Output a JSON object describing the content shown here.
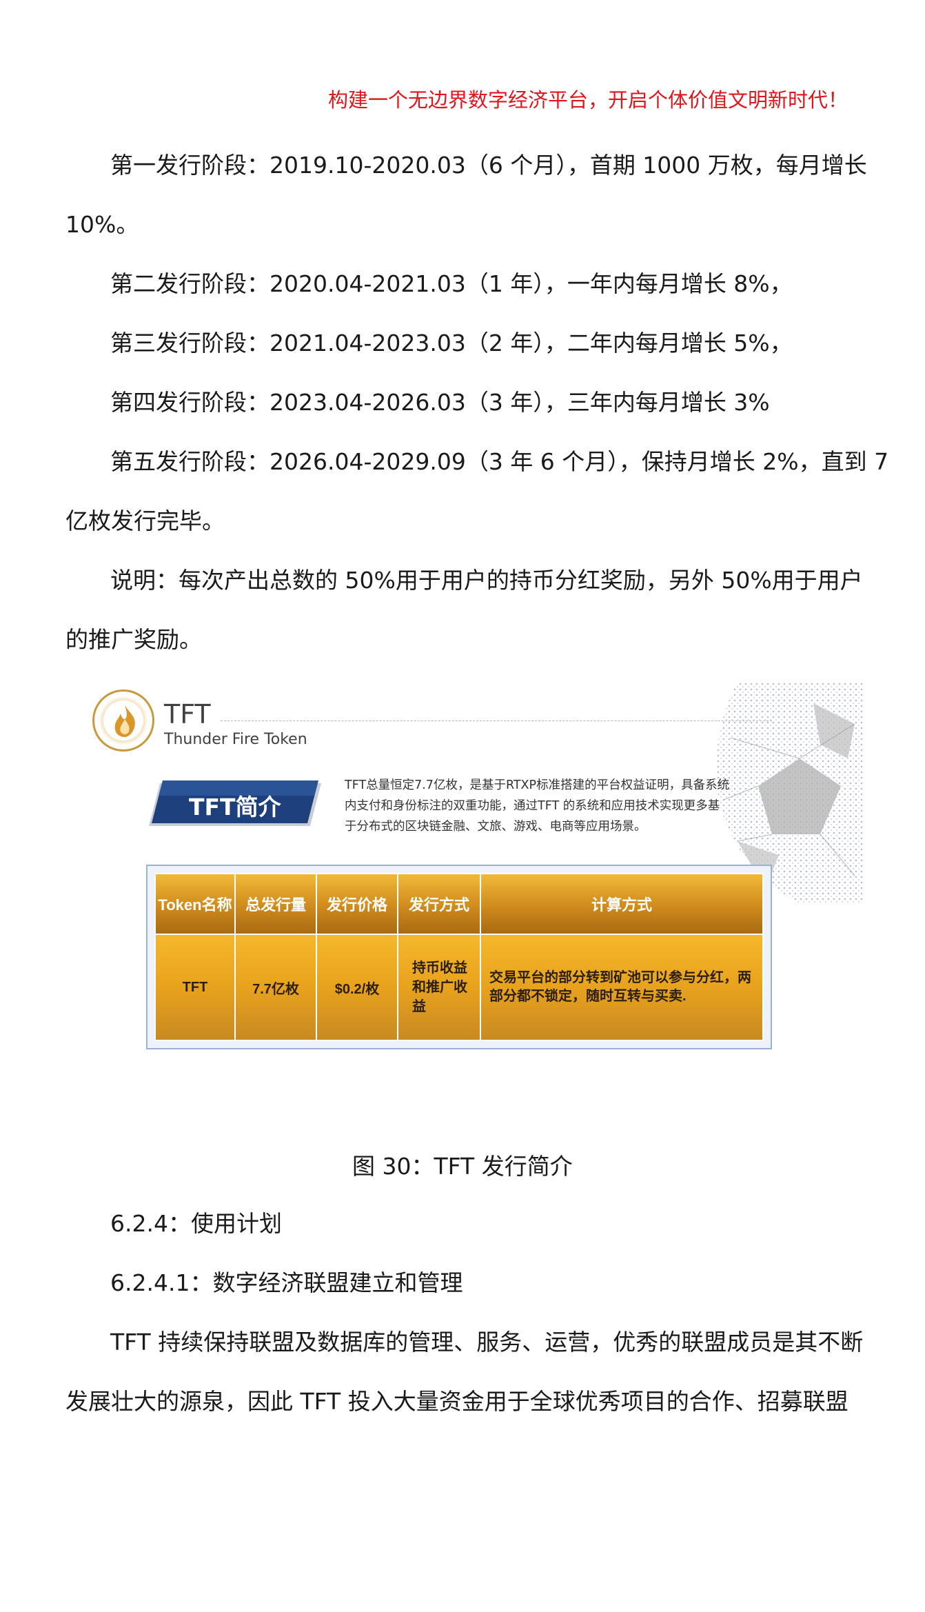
{
  "header": {
    "slogan": "构建一个无边界数字经济平台，开启个体价值文明新时代！"
  },
  "paragraphs": {
    "phase1_line1": "第一发行阶段：2019.10-2020.03（6 个月），首期 1000 万枚，每月增长",
    "phase1_line2": "10%。",
    "phase2": "第二发行阶段：2020.04-2021.03（1 年），一年内每月增长 8%，",
    "phase3": "第三发行阶段：2021.04-2023.03（2 年），二年内每月增长 5%，",
    "phase4": "第四发行阶段：2023.04-2026.03（3 年），三年内每月增长 3%",
    "phase5_line1": "第五发行阶段：2026.04-2029.09（3 年 6 个月），保持月增长 2%，直到 7",
    "phase5_line2": "亿枚发行完毕。",
    "note_line1": "说明：每次产出总数的 50%用于用户的持币分红奖励，另外 50%用于用户",
    "note_line2": "的推广奖励。"
  },
  "figure": {
    "logo_text": "Thunder Fire Token",
    "title": "TFT",
    "subtitle": "Thunder Fire Token",
    "banner_label": "TFT简介",
    "intro_text": "TFT总量恒定7.7亿枚，是基于RTXP标准搭建的平台权益证明，具备系统内支付和身份标注的双重功能，通过TFT 的系统和应用技术实现更多基于分布式的区块链金融、文旅、游戏、电商等应用场景。",
    "table": {
      "headers": [
        "Token名称",
        "总发行量",
        "发行价格",
        "发行方式",
        "计算方式"
      ],
      "row": {
        "name": "TFT",
        "total": "7.7亿枚",
        "price": "$0.2/枚",
        "method": "持币收益和推广收益",
        "calc": "交易平台的部分转到矿池可以参与分红，两部分都不锁定，随时互转与买卖."
      }
    },
    "colors": {
      "gold": "#e8a21d",
      "banner_navy": "#1d3f7c",
      "frame": "#9bb0d6"
    }
  },
  "caption": "图 30：TFT 发行简介",
  "sections": {
    "s624": "6.2.4：使用计划",
    "s6241": "6.2.4.1：数字经济联盟建立和管理",
    "body_line1": "TFT 持续保持联盟及数据库的管理、服务、运营，优秀的联盟成员是其不断",
    "body_line2": "发展壮大的源泉，因此 TFT 投入大量资金用于全球优秀项目的合作、招募联盟"
  }
}
